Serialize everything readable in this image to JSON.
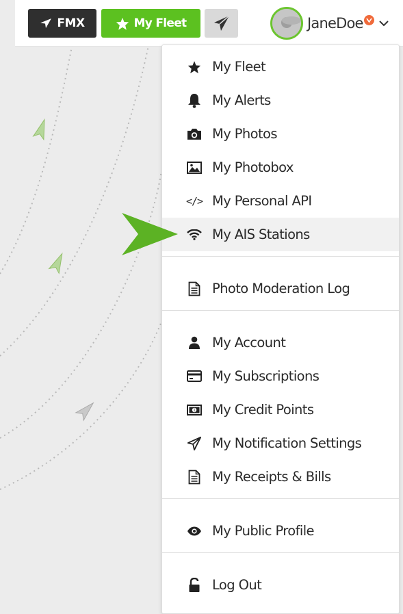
{
  "toolbar": {
    "fmx_label": "FMX",
    "my_fleet_label": "My Fleet",
    "plane_icon": "paper-plane-icon"
  },
  "user": {
    "name": "JaneDoe",
    "avatar_icon": "avatar",
    "badge_color": "#f06a3a",
    "avatar_border_color": "#6cc530"
  },
  "menu": {
    "groups": [
      [
        {
          "id": "my-fleet",
          "label": "My Fleet",
          "icon": "star-icon"
        },
        {
          "id": "my-alerts",
          "label": "My Alerts",
          "icon": "bell-icon"
        },
        {
          "id": "my-photos",
          "label": "My Photos",
          "icon": "camera-icon"
        },
        {
          "id": "my-photobox",
          "label": "My Photobox",
          "icon": "image-icon"
        },
        {
          "id": "my-personal-api",
          "label": "My Personal API",
          "icon": "code-icon"
        },
        {
          "id": "my-ais-stations",
          "label": "My AIS Stations",
          "icon": "wifi-icon",
          "active": true
        }
      ],
      [
        {
          "id": "photo-moderation-log",
          "label": "Photo Moderation Log",
          "icon": "document-icon"
        }
      ],
      [
        {
          "id": "my-account",
          "label": "My Account",
          "icon": "user-icon"
        },
        {
          "id": "my-subscriptions",
          "label": "My Subscriptions",
          "icon": "credit-card-icon"
        },
        {
          "id": "my-credit-points",
          "label": "My Credit Points",
          "icon": "money-icon"
        },
        {
          "id": "my-notification-settings",
          "label": "My Notification Settings",
          "icon": "paper-plane-outline-icon"
        },
        {
          "id": "my-receipts-bills",
          "label": "My Receipts & Bills",
          "icon": "document-icon"
        }
      ],
      [
        {
          "id": "my-public-profile",
          "label": "My Public Profile",
          "icon": "eye-icon"
        }
      ],
      [
        {
          "id": "log-out",
          "label": "Log Out",
          "icon": "unlock-icon"
        }
      ]
    ]
  },
  "colors": {
    "fleet_green": "#5cc120",
    "dark_button": "#2f2f2f",
    "pointer_arrow": "#5cb224",
    "active_row": "#f1f1f1"
  }
}
